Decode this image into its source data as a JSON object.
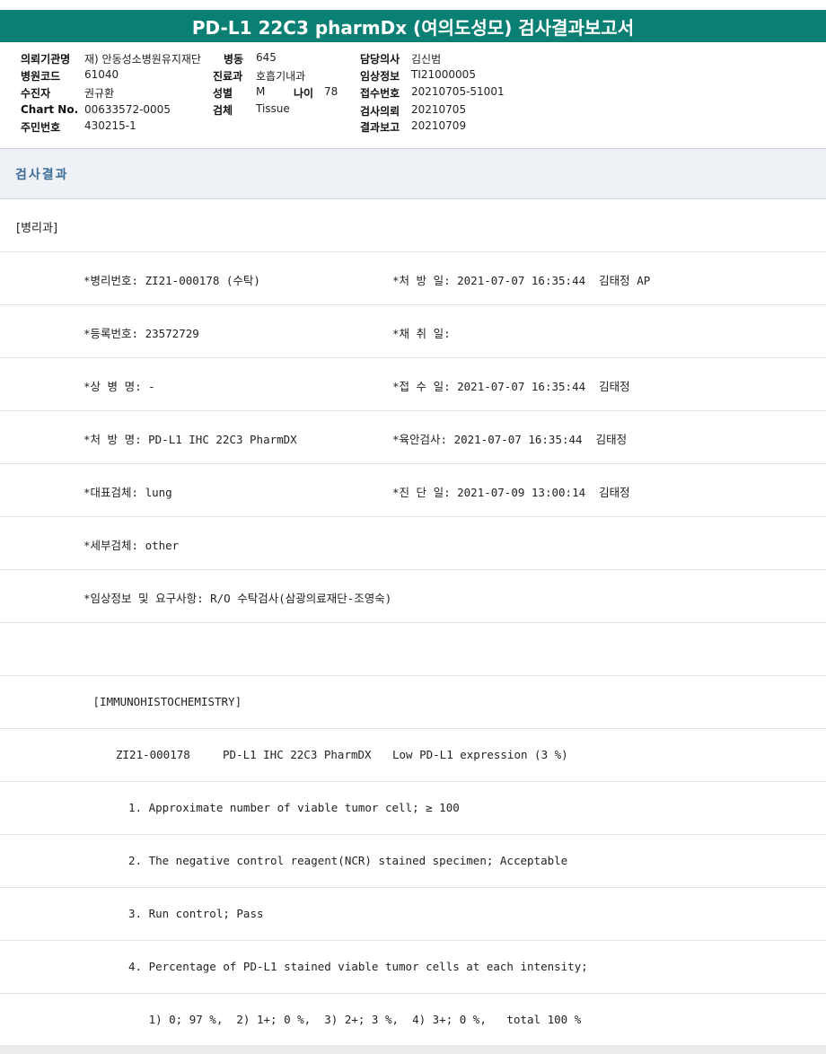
{
  "title": "PD-L1 22C3 pharmDx (여의도성모) 검사결과보고서",
  "info": {
    "institution_label": "의뢰기관명",
    "institution": "재) 안동성소병원유지재단",
    "ward_label": "병동",
    "ward": "645",
    "doctor_label": "담당의사",
    "doctor": "김신범",
    "hospital_code_label": "병원코드",
    "hospital_code": "61040",
    "department_label": "진료과",
    "department": "호흡기내과",
    "clinical_label": "임상정보",
    "clinical": "TI21000005",
    "patient_label": "수진자",
    "patient": "권규환",
    "sex_label": "성별",
    "sex": "M",
    "age_label": "나이",
    "age": "78",
    "receipt_no_label": "접수번호",
    "receipt_no": "20210705-51001",
    "chart_label": "Chart No.",
    "chart": "00633572-0005",
    "specimen_label": "검체",
    "specimen": "Tissue",
    "request_label": "검사의뢰",
    "request": "20210705",
    "resident_label": "주민번호",
    "resident": "430215-1",
    "report_label": "결과보고",
    "report": "20210709"
  },
  "results_header": "검사결과",
  "dept": "[병리과]",
  "rows": [
    {
      "left": "*병리번호: ZI21-000178 (수탁)",
      "right": "*처 방 일: 2021-07-07 16:35:44  김태정 AP"
    },
    {
      "left": "*등록번호: 23572729",
      "right": "*채 취 일:"
    },
    {
      "left": "*상 병 명: -",
      "right": "*접 수 일: 2021-07-07 16:35:44  김태정"
    },
    {
      "left": "*처 방 명: PD-L1 IHC 22C3 PharmDX",
      "right": "*육안검사: 2021-07-07 16:35:44  김태정"
    },
    {
      "left": "*대표검체: lung",
      "right": "*진 단 일: 2021-07-09 13:00:14  김태정"
    },
    {
      "left": "*세부검체: other",
      "right": ""
    },
    {
      "left": "*임상정보 및 요구사항: R/O 수탁검사(삼광의료재단-조영숙)",
      "right": ""
    },
    {
      "left": "",
      "right": ""
    },
    {
      "left": " [IMMUNOHISTOCHEMISTRY]",
      "right": ""
    }
  ],
  "ihc": {
    "id": "ZI21-000178",
    "test": "PD-L1 IHC 22C3 PharmDX",
    "result": "Low PD-L1 expression (3 %)"
  },
  "items": [
    "1. Approximate number of viable tumor cell; ≥ 100",
    "2. The negative control reagent(NCR) stained specimen; Acceptable",
    "3. Run control; Pass",
    "4. Percentage of PD-L1 stained viable tumor cells at each intensity;",
    "   1) 0; 97 %,  2) 1+; 0 %,  3) 2+; 3 %,  4) 3+; 0 %,   total 100 %"
  ]
}
